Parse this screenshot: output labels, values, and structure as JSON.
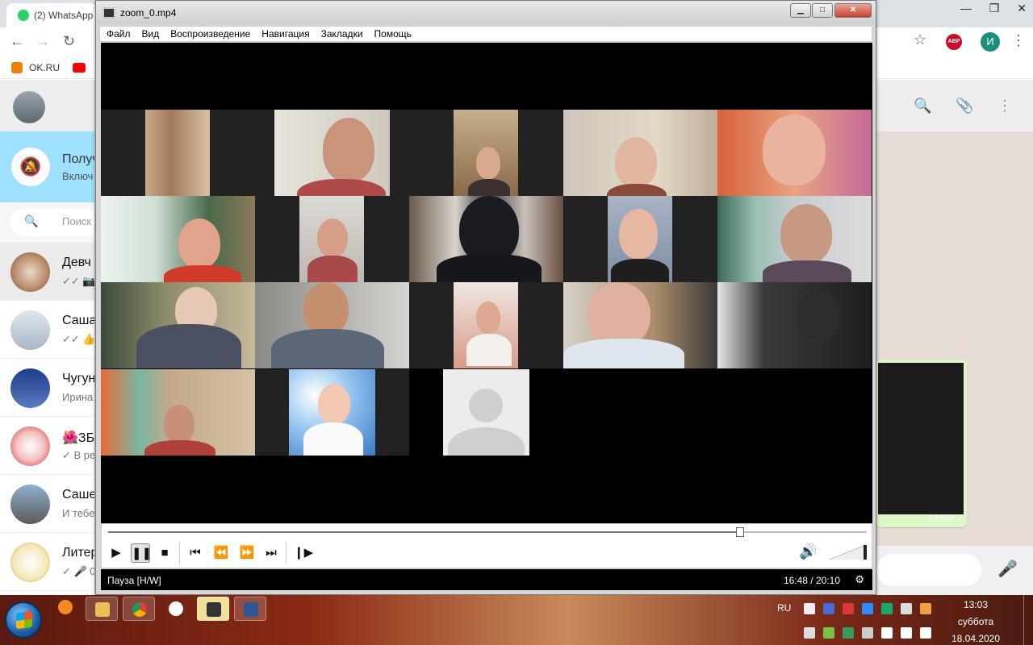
{
  "browser": {
    "tab_title": "(2) WhatsApp",
    "bookmark_ok": "OK.RU",
    "profile_initial": "И",
    "abp_label": "ABP"
  },
  "whatsapp": {
    "notify_title": "Получ",
    "notify_sub": "Включ",
    "search_placeholder": "Поиск",
    "chats": [
      {
        "name": "Девч",
        "preview": "✓✓ 📷"
      },
      {
        "name": "Саша",
        "preview": "✓✓ 👍"
      },
      {
        "name": "Чугун",
        "preview": "Ирина"
      },
      {
        "name": "🌺ЗБ",
        "preview": "✓ В ре"
      },
      {
        "name": "Саше",
        "preview": "И тебе"
      },
      {
        "name": "Литер",
        "preview": "✓ 🎤 0"
      }
    ],
    "bubble_time": "13:02",
    "bubble_ticks": "✓✓"
  },
  "player": {
    "title": "zoom_0.mp4",
    "menu": [
      "Файл",
      "Вид",
      "Воспроизведение",
      "Навигация",
      "Закладки",
      "Помощь"
    ],
    "status": "Пауза [H/W]",
    "time": "16:48 / 20:10",
    "progress": 0.833,
    "volume": 1.0
  },
  "taskbar": {
    "lang": "RU",
    "time": "13:03",
    "day": "суббота",
    "date": "18.04.2020"
  }
}
